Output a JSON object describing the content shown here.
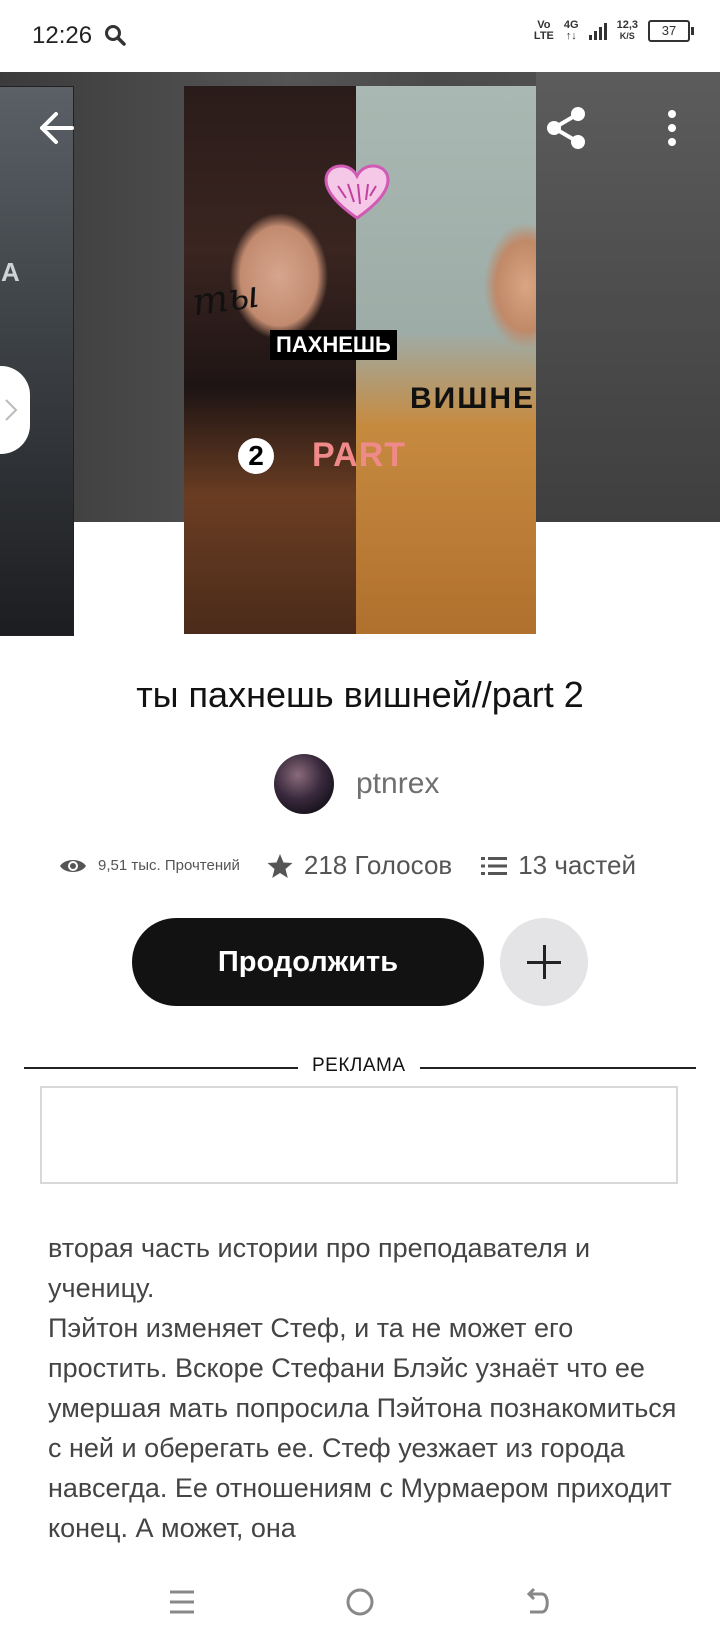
{
  "status_bar": {
    "time": "12:26",
    "net_volte_top": "Vo",
    "net_volte_bottom": "LTE",
    "net_4g": "4G",
    "speed_value": "12,3",
    "speed_unit": "K/S",
    "battery": "37"
  },
  "cover": {
    "left_cover_text": "А",
    "text_ty": "ты",
    "text_pakhnesh": "ПАХНЕШЬ",
    "text_vishney": "ВИШНЕЙ",
    "text_two": "2",
    "text_part": "PART"
  },
  "story": {
    "title": "ты пахнешь вишней//part 2",
    "author": "ptnrex",
    "reads": "9,51 тыс. Прочтений",
    "votes": "218 Голосов",
    "parts": "13 частей",
    "continue_label": "Продолжить",
    "ad_label": "РЕКЛАМА",
    "description": "вторая часть истории про преподавателя и ученицу.\nПэйтон изменяет Стеф, и та не может его простить. Вскоре Стефани Блэйс узнаёт что ее умершая мать попросила Пэйтона познакомиться с ней и оберегать ее. Стеф уезжает из города навсегда. Ее отношениям с Мурмаером приходит конец. А может, она"
  }
}
